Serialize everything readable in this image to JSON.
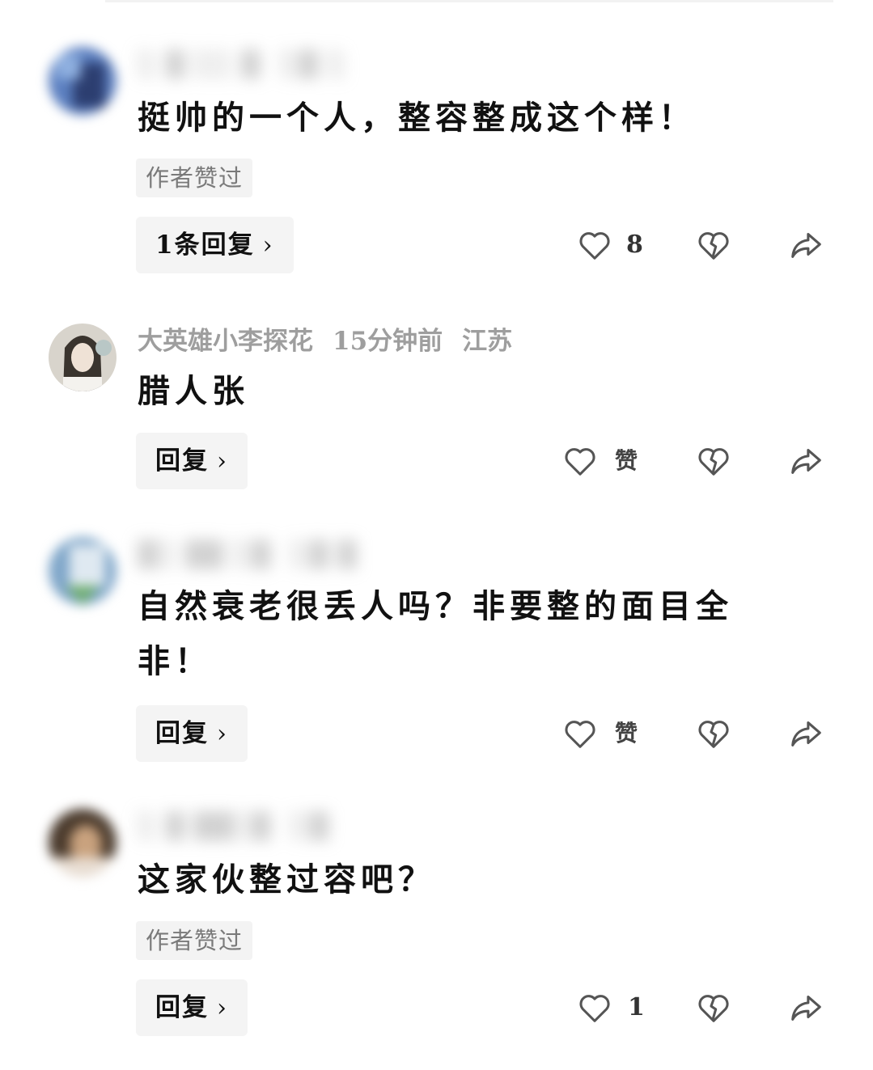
{
  "comments": [
    {
      "username": "",
      "time": "",
      "location": "",
      "text": "挺帅的一个人，整容整成这个样！",
      "badge": "作者赞过",
      "reply_label": "1条回复",
      "like_count": "8"
    },
    {
      "username": "大英雄小李探花",
      "time": "15分钟前",
      "location": "江苏",
      "text": "腊人张",
      "badge": "",
      "reply_label": "回复",
      "like_count": "赞"
    },
    {
      "username": "",
      "time": "",
      "location": "",
      "text": "自然衰老很丢人吗？非要整的面目全非！",
      "badge": "",
      "reply_label": "回复",
      "like_count": "赞"
    },
    {
      "username": "",
      "time": "",
      "location": "",
      "text": "这家伙整过容吧？",
      "badge": "作者赞过",
      "reply_label": "回复",
      "like_count": "1"
    }
  ],
  "icons": {
    "like": "heart-outline-icon",
    "dislike": "broken-heart-icon",
    "share": "share-arrow-icon",
    "reply_chevron": "chevron-right-icon"
  },
  "colors": {
    "text": "#111111",
    "meta": "#9e9e9e",
    "badge_bg": "#f3f3f3",
    "button_bg": "#f4f4f4",
    "icon": "#555555"
  }
}
